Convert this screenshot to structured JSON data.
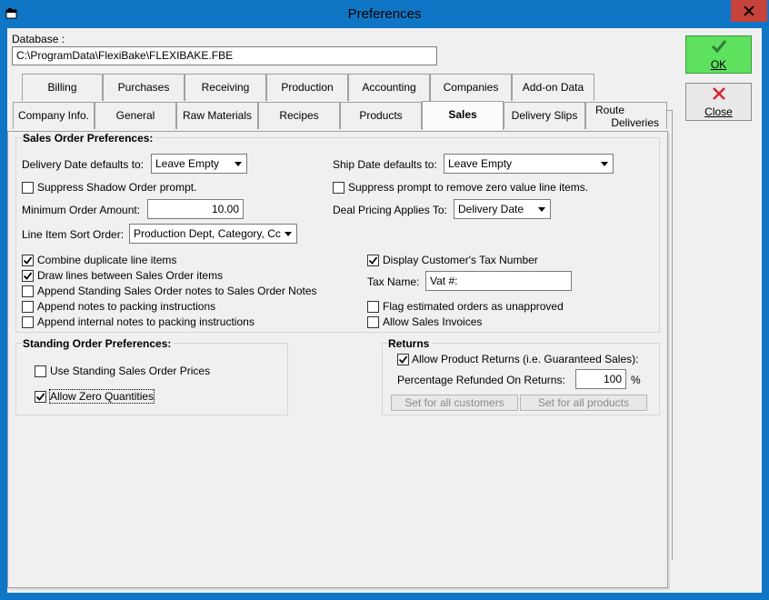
{
  "window": {
    "title": "Preferences"
  },
  "database": {
    "label": "Database :",
    "path": "C:\\ProgramData\\FlexiBake\\FLEXIBAKE.FBE"
  },
  "buttons": {
    "ok": "OK",
    "close": "Close"
  },
  "tabs_row1": [
    "Billing",
    "Purchases",
    "Receiving",
    "Production",
    "Accounting",
    "Companies",
    "Add-on Data"
  ],
  "tabs_row2": [
    "Company Info.",
    "General",
    "Raw Materials",
    "Recipes",
    "Products",
    "Sales",
    "Delivery Slips"
  ],
  "tab_route": {
    "line1": "Route",
    "line2": "Deliveries"
  },
  "active_tab": "Sales",
  "sales_order": {
    "title": "Sales Order Preferences:",
    "delivery_date_label": "Delivery Date defaults to:",
    "delivery_date_value": "Leave Empty",
    "ship_date_label": "Ship Date defaults to:",
    "ship_date_value": "Leave Empty",
    "suppress_shadow": {
      "label": "Suppress Shadow Order prompt.",
      "checked": false
    },
    "suppress_zero": {
      "label": "Suppress prompt to remove zero value line items.",
      "checked": false
    },
    "min_order_label": "Minimum Order Amount:",
    "min_order_value": "10.00",
    "deal_pricing_label": "Deal Pricing Applies To:",
    "deal_pricing_value": "Delivery Date",
    "sort_order_label": "Line Item Sort Order:",
    "sort_order_value": "Production Dept, Category, Cc",
    "combine_duplicate": {
      "label": "Combine duplicate line items",
      "checked": true
    },
    "draw_lines": {
      "label": "Draw lines between Sales Order items",
      "checked": true
    },
    "append_standing": {
      "label": "Append Standing Sales Order notes to Sales Order Notes",
      "checked": false
    },
    "append_packing": {
      "label": "Append notes to packing instructions",
      "checked": false
    },
    "append_internal": {
      "label": "Append internal notes to packing instructions",
      "checked": false
    },
    "display_tax": {
      "label": "Display Customer's Tax Number",
      "checked": true
    },
    "tax_name_label": "Tax Name:",
    "tax_name_value": "Vat #:",
    "flag_estimated": {
      "label": "Flag estimated orders as unapproved",
      "checked": false
    },
    "allow_invoices": {
      "label": "Allow Sales Invoices",
      "checked": false
    }
  },
  "standing_order": {
    "title": "Standing Order Preferences:",
    "use_prices": {
      "label": "Use Standing Sales Order Prices",
      "checked": false
    },
    "allow_zero": {
      "label": "Allow Zero Quantities",
      "checked": true
    }
  },
  "returns": {
    "title": "Returns",
    "allow_returns": {
      "label": "Allow Product Returns (i.e. Guaranteed Sales):",
      "checked": true
    },
    "pct_label": "Percentage Refunded On Returns:",
    "pct_value": "100",
    "pct_unit": "%",
    "set_customers": "Set for all customers",
    "set_products": "Set for all products"
  },
  "colors": {
    "titlebar": "#0f76c6",
    "close": "#c6423a",
    "ok_green": "#5ee15e",
    "close_x": "#d9232e"
  }
}
